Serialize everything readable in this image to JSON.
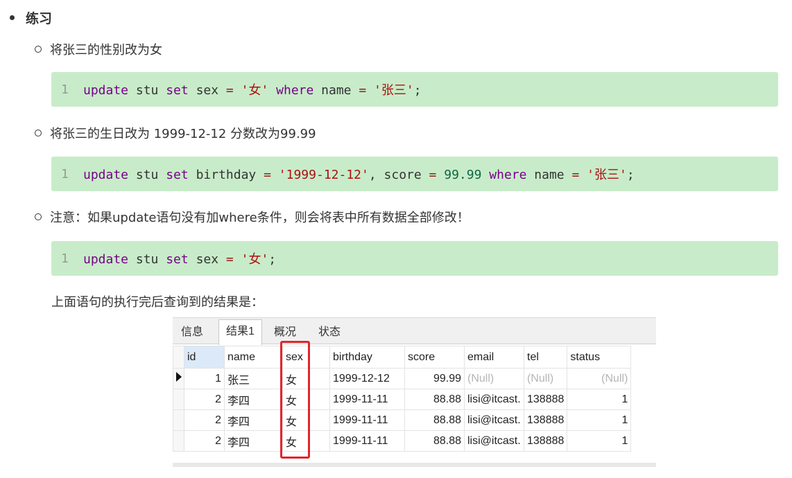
{
  "section": {
    "title": "练习"
  },
  "items": [
    {
      "label": "将张三的性别改为女"
    },
    {
      "label": "将张三的生日改为 1999-12-12 分数改为99.99"
    },
    {
      "label": "注意：如果update语句没有加where条件，则会将表中所有数据全部修改！"
    }
  ],
  "code": [
    {
      "line": "1"
    },
    {
      "line": "1"
    },
    {
      "line": "1"
    }
  ],
  "paragraph": "上面语句的执行完后查询到的结果是：",
  "result": {
    "tabs": [
      "信息",
      "结果1",
      "概况",
      "状态"
    ],
    "active_tab": "结果1",
    "columns": [
      "id",
      "name",
      "sex",
      "birthday",
      "score",
      "email",
      "tel",
      "status"
    ],
    "rows": [
      [
        "1",
        "张三",
        "女",
        "1999-12-12",
        "99.99",
        "(Null)",
        "(Null)",
        "(Null)"
      ],
      [
        "2",
        "李四",
        "女",
        "1999-11-11",
        "88.88",
        "lisi@itcast.",
        "138888",
        "1"
      ],
      [
        "2",
        "李四",
        "女",
        "1999-11-11",
        "88.88",
        "lisi@itcast.",
        "138888",
        "1"
      ],
      [
        "2",
        "李四",
        "女",
        "1999-11-11",
        "88.88",
        "lisi@itcast.",
        "138888",
        "1"
      ]
    ],
    "highlight_color": "#e0262b"
  },
  "colors": {
    "code_background": "#c8ecc9",
    "keyword": "#770088",
    "string": "#aa1111",
    "number": "#116644"
  }
}
